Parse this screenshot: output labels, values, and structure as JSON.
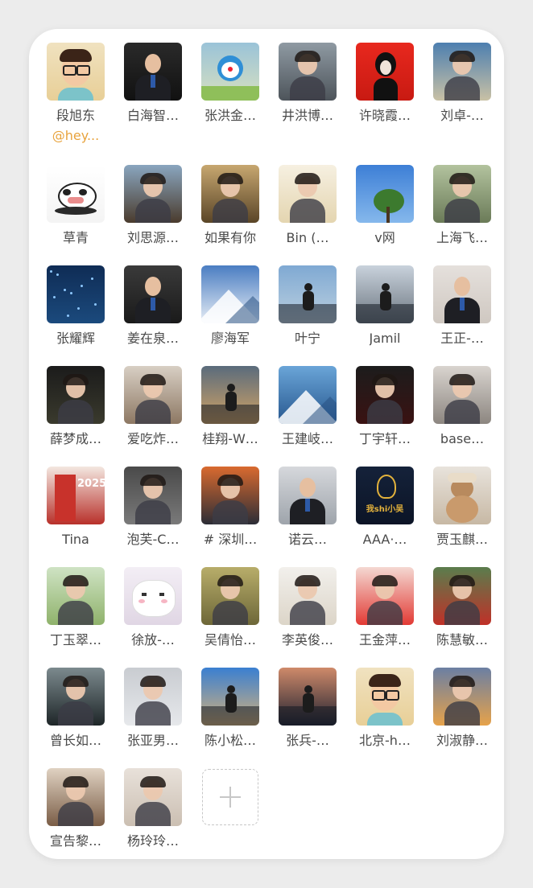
{
  "members": [
    {
      "name": "段旭东",
      "sub": "@hey...",
      "avatar": "cartoon-man-glasses",
      "bg": "linear-gradient(#f0e2c0,#e8cf97)"
    },
    {
      "name": "白海智…",
      "avatar": "man-suit-dark",
      "bg": "linear-gradient(#2a2a2a,#111)"
    },
    {
      "name": "张洪金…",
      "avatar": "doraemon",
      "bg": "linear-gradient(#9ac3d8,#d8e0c0)"
    },
    {
      "name": "井洪博…",
      "avatar": "street-scene",
      "bg": "linear-gradient(#8f9aa3,#4d545a)"
    },
    {
      "name": "许晓霞…",
      "avatar": "red-illustration",
      "bg": "linear-gradient(#e8281e,#c81a12)"
    },
    {
      "name": "刘卓-…",
      "avatar": "man-by-water",
      "bg": "linear-gradient(#4d7fb0,#c9c1a5)"
    },
    {
      "name": "草青",
      "avatar": "cartoon-cow",
      "bg": "linear-gradient(#ffffff,#f4f4f4)"
    },
    {
      "name": "刘思源…",
      "avatar": "people-sitting-outdoors",
      "bg": "linear-gradient(#8aa6bf,#4a3b2d)"
    },
    {
      "name": "如果有你",
      "avatar": "child-hat-photo",
      "bg": "linear-gradient(#c7a770,#5a4527)"
    },
    {
      "name": "Bin (…",
      "avatar": "sketch-traveler",
      "bg": "linear-gradient(#f6f0e1,#e4d5b0)"
    },
    {
      "name": "v网",
      "avatar": "tree-blue-sky",
      "bg": "linear-gradient(#3d7fd6,#85b8ec)"
    },
    {
      "name": "上海飞…",
      "avatar": "woman-garden",
      "bg": "linear-gradient(#b3c39e,#6b7b58)"
    },
    {
      "name": "张耀辉",
      "avatar": "starry-blue",
      "bg": "linear-gradient(#0f2c55,#1b4a7d)"
    },
    {
      "name": "姜在泉…",
      "avatar": "man-suit-portrait",
      "bg": "linear-gradient(#3a3a3a,#1a1a1a)"
    },
    {
      "name": "廖海军",
      "avatar": "snowy-mountains",
      "bg": "linear-gradient(#4a7dc2,#e8eef5)"
    },
    {
      "name": "叶宁",
      "avatar": "man-at-sea",
      "bg": "linear-gradient(#7fa9d3,#bcd0df)"
    },
    {
      "name": "Jamil",
      "avatar": "man-city",
      "bg": "linear-gradient(#c9d2dc,#6c7680)"
    },
    {
      "name": "王正-…",
      "avatar": "man-hands-pressed",
      "bg": "linear-gradient(#e5e0dc,#cfc8c1)"
    },
    {
      "name": "薛梦成…",
      "avatar": "dark-station",
      "bg": "linear-gradient(#1b1b1b,#3a3a2d)"
    },
    {
      "name": "爱吃炸…",
      "avatar": "woman-with-dogs",
      "bg": "linear-gradient(#d8cfc4,#8d7863)"
    },
    {
      "name": "桂翔-W…",
      "avatar": "silhouette-sunset",
      "bg": "linear-gradient(#5a6b7c,#d3a465)"
    },
    {
      "name": "王建岐…",
      "avatar": "blue-mountains",
      "bg": "linear-gradient(#6aa5d8,#27578e)"
    },
    {
      "name": "丁宇轩…",
      "avatar": "girl-red-dress",
      "bg": "linear-gradient(#1c1c1c,#3a1212)"
    },
    {
      "name": "base…",
      "avatar": "young-girl",
      "bg": "linear-gradient(#d9d4cf,#8c8680)"
    },
    {
      "name": "Tina",
      "avatar": "red-door-2025",
      "bg": "linear-gradient(#f3e7e0,#b8302a)"
    },
    {
      "name": "泡芙-C…",
      "avatar": "woman-red-top",
      "bg": "linear-gradient(#4a4a4a,#7a7a7a)"
    },
    {
      "name": "# 深圳…",
      "avatar": "city-aerial",
      "bg": "linear-gradient(#d96a2f,#2b2d36)"
    },
    {
      "name": "诺云…",
      "avatar": "man-glasses-group",
      "bg": "linear-gradient(#d6d8dc,#9ea4ab)"
    },
    {
      "name": "AAA·…",
      "avatar": "dark-logo",
      "bg": "linear-gradient(#15223a,#0b1426)",
      "logo_text": "我shi小吴"
    },
    {
      "name": "贾玉麒…",
      "avatar": "teddy-bear",
      "bg": "linear-gradient(#e8e3dc,#c7b8a4)"
    },
    {
      "name": "丁玉翠…",
      "avatar": "girl-braid-field",
      "bg": "linear-gradient(#cfe3c4,#8fb26b)"
    },
    {
      "name": "徐放-…",
      "avatar": "white-cat-cartoon",
      "bg": "linear-gradient(#f3eef5,#e0d6e4)"
    },
    {
      "name": "吴倩怡…",
      "avatar": "vintage-photo",
      "bg": "linear-gradient(#b8ad6a,#6d6738)"
    },
    {
      "name": "李英俊…",
      "avatar": "illustrated-woman",
      "bg": "linear-gradient(#f2f0ec,#dcd5c8)"
    },
    {
      "name": "王金萍…",
      "avatar": "woman-red-flag",
      "bg": "linear-gradient(#f4d8d2,#e23a34)"
    },
    {
      "name": "陈慧敏…",
      "avatar": "woman-smiling-outdoors",
      "bg": "linear-gradient(#5a7d4d,#c03028)"
    },
    {
      "name": "曾长如…",
      "avatar": "hooded-person",
      "bg": "linear-gradient(#7c8a8e,#1e2628)"
    },
    {
      "name": "张亚男…",
      "avatar": "woman-white-coat",
      "bg": "linear-gradient(#c9ccd1,#e6e8eb)"
    },
    {
      "name": "陈小松…",
      "avatar": "jumping-person",
      "bg": "linear-gradient(#3a7fd1,#d6b27a)"
    },
    {
      "name": "张兵-…",
      "avatar": "sunset-figure",
      "bg": "linear-gradient(#cf8a6a,#1e2130)"
    },
    {
      "name": "北京-h…",
      "avatar": "cartoon-man-glasses",
      "bg": "linear-gradient(#f0e2c0,#e8cf97)"
    },
    {
      "name": "刘淑静…",
      "avatar": "beach-sunset",
      "bg": "linear-gradient(#6b7fa3,#e6a24a)"
    },
    {
      "name": "宣告黎…",
      "avatar": "woman-with-cat",
      "bg": "linear-gradient(#e0d2c2,#7a5d46)"
    },
    {
      "name": "杨玲玲…",
      "avatar": "woman-portrait",
      "bg": "linear-gradient(#e8e1da,#cbbfb2)"
    }
  ],
  "add_button": {
    "icon": "plus-icon"
  }
}
